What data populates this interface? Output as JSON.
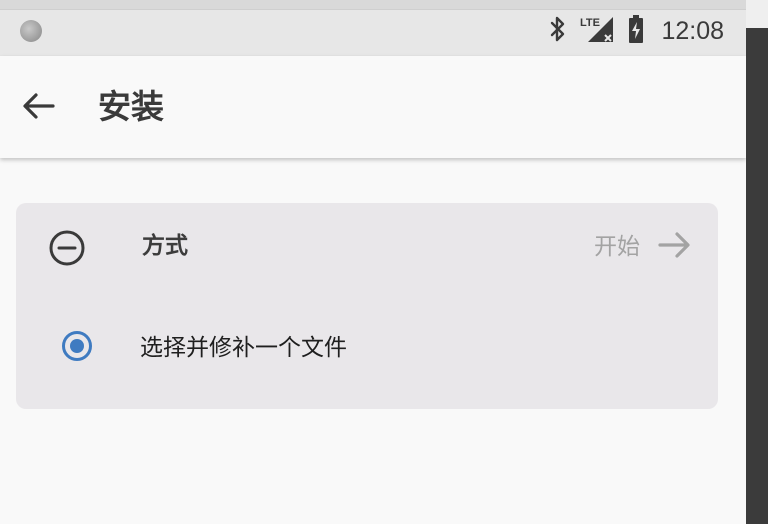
{
  "status_bar": {
    "time": "12:08",
    "icons": [
      "notification-dot-icon",
      "bluetooth-icon",
      "lte-signal-icon",
      "battery-icon"
    ],
    "network_label": "LTE"
  },
  "app_bar": {
    "back_icon": "arrow-left-icon",
    "title": "安装"
  },
  "step": {
    "icon": "minus-circle-icon",
    "label": "方式",
    "start_label": "开始",
    "start_icon": "arrow-right-icon"
  },
  "option": {
    "selected": true,
    "label": "选择并修补一个文件"
  },
  "colors": {
    "accent": "#3f7bc1",
    "card_background": "#e9e7ea",
    "page_background": "#f9f9f9",
    "disabled_text": "#a3a3a3"
  }
}
